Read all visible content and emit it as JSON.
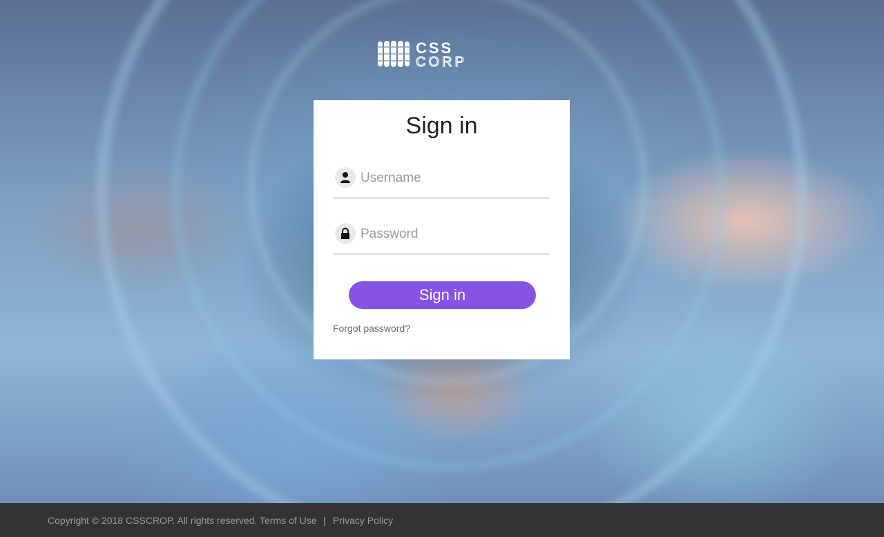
{
  "brand": {
    "logo_text_top": "CSS",
    "logo_text_bottom": "CORP",
    "logo_icon": "grid-logo-icon"
  },
  "login": {
    "title": "Sign in",
    "username": {
      "placeholder": "Username",
      "value": "",
      "icon": "user-icon"
    },
    "password": {
      "placeholder": "Password",
      "value": "",
      "icon": "lock-icon"
    },
    "submit_label": "Sign in",
    "forgot_label": "Forgot password?"
  },
  "footer": {
    "copyright": "Copyright © 2018 CSSCROP. All rights reserved.",
    "terms_label": "Terms of Use",
    "separator": "|",
    "privacy_label": "Privacy Policy"
  },
  "colors": {
    "accent": "#8653e6",
    "footer_bg": "#333333",
    "card_bg": "#ffffff"
  }
}
